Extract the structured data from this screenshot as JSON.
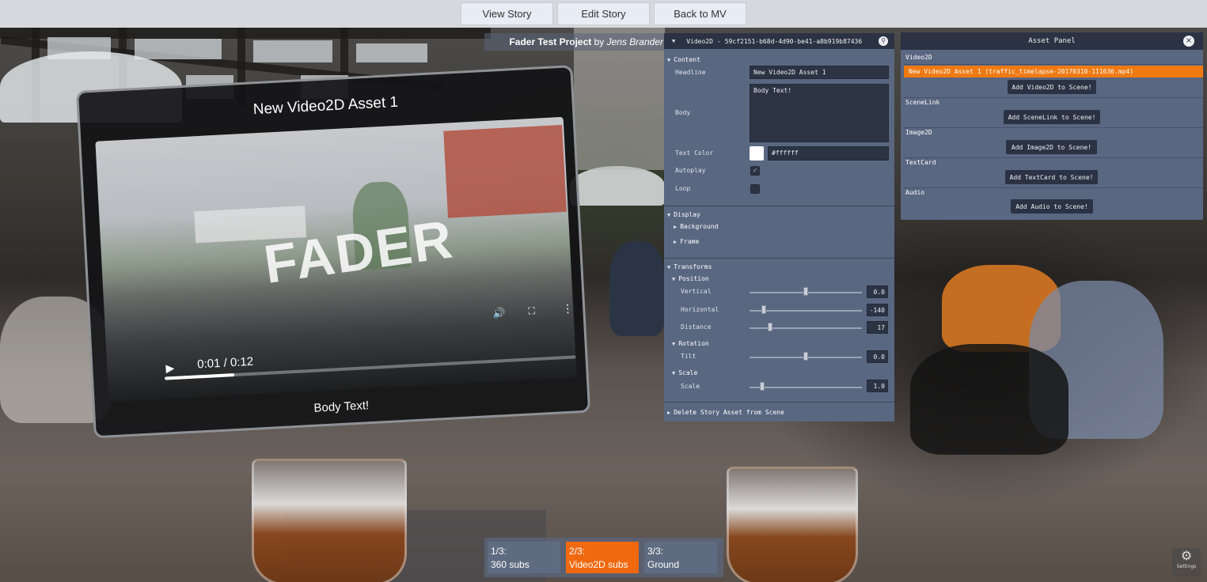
{
  "topbar": {
    "buttons": [
      "View Story",
      "Edit Story",
      "Back to MV"
    ]
  },
  "project": {
    "title": "Fader Test Project",
    "by": "by",
    "author": "Jens Brander"
  },
  "card": {
    "title": "New Video2D Asset 1",
    "video_text": "FADER",
    "time": "0:01 / 0:12",
    "body": "Body Text!",
    "progress": 0.17
  },
  "inspector": {
    "type": "Video2D",
    "id": "59cf2151-b68d-4d90-be41-a8b919b87436",
    "sections": {
      "content": "Content",
      "display": "Display",
      "transforms": "Transforms",
      "delete": "Delete Story Asset from Scene"
    },
    "content": {
      "headline_label": "Headline",
      "headline_value": "New Video2D Asset 1",
      "body_label": "Body",
      "body_value": "Body Text!",
      "text_color_label": "Text Color",
      "text_color_value": "#ffffff",
      "autoplay_label": "Autoplay",
      "autoplay_checked": true,
      "loop_label": "Loop",
      "loop_checked": false
    },
    "display": {
      "background": "Background",
      "frame": "Frame"
    },
    "transforms": {
      "position": "Position",
      "vertical_label": "Vertical",
      "vertical_value": "0.0",
      "horizontal_label": "Horizontal",
      "horizontal_value": "-140",
      "distance_label": "Distance",
      "distance_value": "17",
      "rotation": "Rotation",
      "tilt_label": "Tilt",
      "tilt_value": "0.0",
      "scale_group": "Scale",
      "scale_label": "Scale",
      "scale_value": "1.0"
    }
  },
  "asset_panel": {
    "title": "Asset Panel",
    "close": "×",
    "selected_item": "New Video2D Asset 1 (traffic_timelapse-20170310-111636.mp4)",
    "categories": [
      {
        "name": "Video2D",
        "button": "Add Video2D to Scene!"
      },
      {
        "name": "SceneLink",
        "button": "Add SceneLink to Scene!"
      },
      {
        "name": "Image2D",
        "button": "Add Image2D to Scene!"
      },
      {
        "name": "TextCard",
        "button": "Add TextCard to Scene!"
      },
      {
        "name": "Audio",
        "button": "Add Audio to Scene!"
      }
    ]
  },
  "scenes": [
    {
      "index": "1/3:",
      "name": "360 subs",
      "active": false
    },
    {
      "index": "2/3:",
      "name": "Video2D subs",
      "active": true
    },
    {
      "index": "3/3:",
      "name": "Ground",
      "active": false
    }
  ],
  "settings": {
    "label": "Settings",
    "icon": "gear-icon"
  },
  "colors": {
    "accent": "#f0690f",
    "panel": "#5a6781",
    "panel_dark": "#2b3243"
  }
}
